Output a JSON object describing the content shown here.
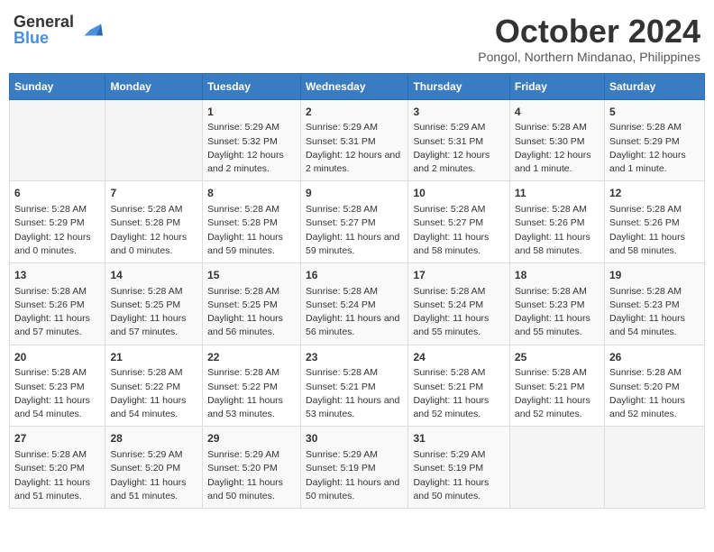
{
  "logo": {
    "line1": "General",
    "line2": "Blue"
  },
  "title": "October 2024",
  "subtitle": "Pongol, Northern Mindanao, Philippines",
  "days_of_week": [
    "Sunday",
    "Monday",
    "Tuesday",
    "Wednesday",
    "Thursday",
    "Friday",
    "Saturday"
  ],
  "weeks": [
    [
      {
        "day": "",
        "info": ""
      },
      {
        "day": "",
        "info": ""
      },
      {
        "day": "1",
        "info": "Sunrise: 5:29 AM\nSunset: 5:32 PM\nDaylight: 12 hours and 2 minutes."
      },
      {
        "day": "2",
        "info": "Sunrise: 5:29 AM\nSunset: 5:31 PM\nDaylight: 12 hours and 2 minutes."
      },
      {
        "day": "3",
        "info": "Sunrise: 5:29 AM\nSunset: 5:31 PM\nDaylight: 12 hours and 2 minutes."
      },
      {
        "day": "4",
        "info": "Sunrise: 5:28 AM\nSunset: 5:30 PM\nDaylight: 12 hours and 1 minute."
      },
      {
        "day": "5",
        "info": "Sunrise: 5:28 AM\nSunset: 5:29 PM\nDaylight: 12 hours and 1 minute."
      }
    ],
    [
      {
        "day": "6",
        "info": "Sunrise: 5:28 AM\nSunset: 5:29 PM\nDaylight: 12 hours and 0 minutes."
      },
      {
        "day": "7",
        "info": "Sunrise: 5:28 AM\nSunset: 5:28 PM\nDaylight: 12 hours and 0 minutes."
      },
      {
        "day": "8",
        "info": "Sunrise: 5:28 AM\nSunset: 5:28 PM\nDaylight: 11 hours and 59 minutes."
      },
      {
        "day": "9",
        "info": "Sunrise: 5:28 AM\nSunset: 5:27 PM\nDaylight: 11 hours and 59 minutes."
      },
      {
        "day": "10",
        "info": "Sunrise: 5:28 AM\nSunset: 5:27 PM\nDaylight: 11 hours and 58 minutes."
      },
      {
        "day": "11",
        "info": "Sunrise: 5:28 AM\nSunset: 5:26 PM\nDaylight: 11 hours and 58 minutes."
      },
      {
        "day": "12",
        "info": "Sunrise: 5:28 AM\nSunset: 5:26 PM\nDaylight: 11 hours and 58 minutes."
      }
    ],
    [
      {
        "day": "13",
        "info": "Sunrise: 5:28 AM\nSunset: 5:26 PM\nDaylight: 11 hours and 57 minutes."
      },
      {
        "day": "14",
        "info": "Sunrise: 5:28 AM\nSunset: 5:25 PM\nDaylight: 11 hours and 57 minutes."
      },
      {
        "day": "15",
        "info": "Sunrise: 5:28 AM\nSunset: 5:25 PM\nDaylight: 11 hours and 56 minutes."
      },
      {
        "day": "16",
        "info": "Sunrise: 5:28 AM\nSunset: 5:24 PM\nDaylight: 11 hours and 56 minutes."
      },
      {
        "day": "17",
        "info": "Sunrise: 5:28 AM\nSunset: 5:24 PM\nDaylight: 11 hours and 55 minutes."
      },
      {
        "day": "18",
        "info": "Sunrise: 5:28 AM\nSunset: 5:23 PM\nDaylight: 11 hours and 55 minutes."
      },
      {
        "day": "19",
        "info": "Sunrise: 5:28 AM\nSunset: 5:23 PM\nDaylight: 11 hours and 54 minutes."
      }
    ],
    [
      {
        "day": "20",
        "info": "Sunrise: 5:28 AM\nSunset: 5:23 PM\nDaylight: 11 hours and 54 minutes."
      },
      {
        "day": "21",
        "info": "Sunrise: 5:28 AM\nSunset: 5:22 PM\nDaylight: 11 hours and 54 minutes."
      },
      {
        "day": "22",
        "info": "Sunrise: 5:28 AM\nSunset: 5:22 PM\nDaylight: 11 hours and 53 minutes."
      },
      {
        "day": "23",
        "info": "Sunrise: 5:28 AM\nSunset: 5:21 PM\nDaylight: 11 hours and 53 minutes."
      },
      {
        "day": "24",
        "info": "Sunrise: 5:28 AM\nSunset: 5:21 PM\nDaylight: 11 hours and 52 minutes."
      },
      {
        "day": "25",
        "info": "Sunrise: 5:28 AM\nSunset: 5:21 PM\nDaylight: 11 hours and 52 minutes."
      },
      {
        "day": "26",
        "info": "Sunrise: 5:28 AM\nSunset: 5:20 PM\nDaylight: 11 hours and 52 minutes."
      }
    ],
    [
      {
        "day": "27",
        "info": "Sunrise: 5:28 AM\nSunset: 5:20 PM\nDaylight: 11 hours and 51 minutes."
      },
      {
        "day": "28",
        "info": "Sunrise: 5:29 AM\nSunset: 5:20 PM\nDaylight: 11 hours and 51 minutes."
      },
      {
        "day": "29",
        "info": "Sunrise: 5:29 AM\nSunset: 5:20 PM\nDaylight: 11 hours and 50 minutes."
      },
      {
        "day": "30",
        "info": "Sunrise: 5:29 AM\nSunset: 5:19 PM\nDaylight: 11 hours and 50 minutes."
      },
      {
        "day": "31",
        "info": "Sunrise: 5:29 AM\nSunset: 5:19 PM\nDaylight: 11 hours and 50 minutes."
      },
      {
        "day": "",
        "info": ""
      },
      {
        "day": "",
        "info": ""
      }
    ]
  ]
}
